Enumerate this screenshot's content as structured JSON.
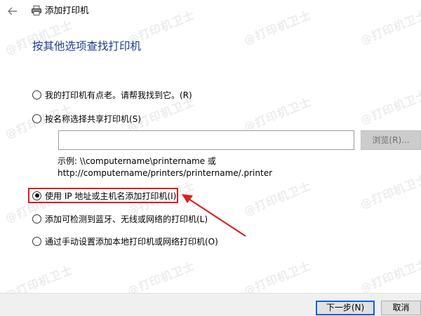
{
  "window": {
    "title": "添加打印机"
  },
  "heading": "按其他选项查找打印机",
  "options": [
    {
      "label": "我的打印机有点老。请帮我找到它。(R)",
      "checked": false
    },
    {
      "label": "按名称选择共享打印机(S)",
      "checked": false
    },
    {
      "label": "使用 IP 地址或主机名添加打印机(I)",
      "checked": true
    },
    {
      "label": "添加可检测到蓝牙、无线或网络的打印机(L)",
      "checked": false
    },
    {
      "label": "通过手动设置添加本地打印机或网络打印机(O)",
      "checked": false
    }
  ],
  "share_input": {
    "value": ""
  },
  "browse_label": "浏览(R)...",
  "example": {
    "line1": "示例: \\\\computername\\printername 或",
    "line2": "http://computername/printers/printername/.printer"
  },
  "buttons": {
    "next": "下一步(N)",
    "cancel": "取消"
  },
  "watermark_text": "@打印机卫士",
  "colors": {
    "heading": "#1b3e8f",
    "highlight": "#e11c1c",
    "primary_button_border": "#0a64d8"
  },
  "icons": [
    "back-arrow-icon",
    "printer-icon",
    "red-pointer-arrow"
  ]
}
